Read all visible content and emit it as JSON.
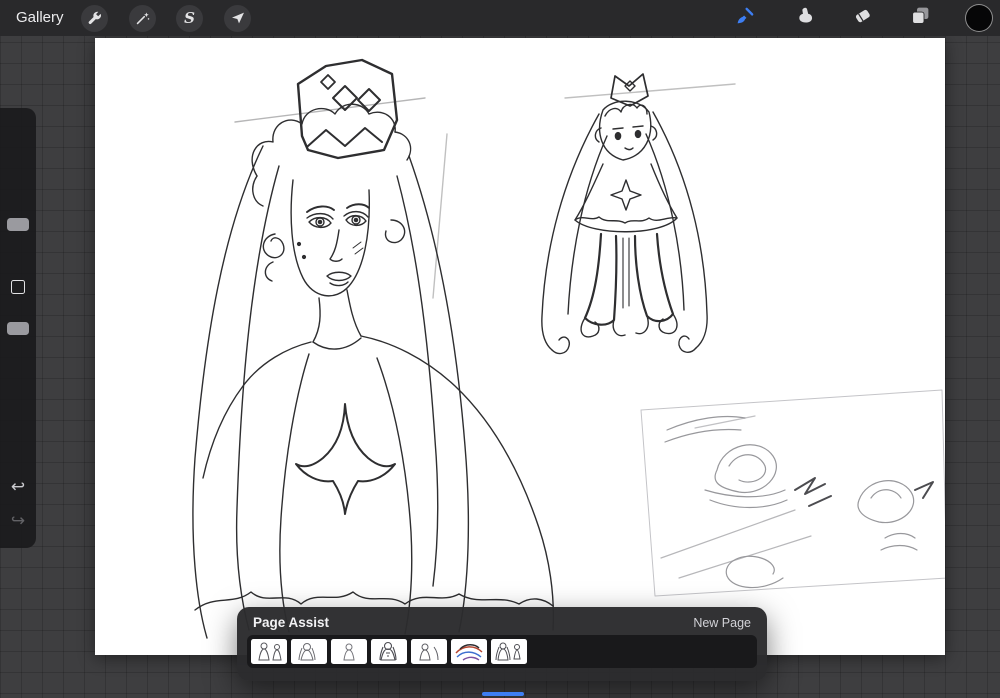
{
  "top_bar": {
    "gallery_label": "Gallery",
    "selection_letter": "S",
    "left_tools": [
      "actions-wrench-icon",
      "adjustments-wand-icon",
      "selection-s-icon",
      "transform-arrow-icon"
    ],
    "right_tools": [
      "paint-brush-icon",
      "smudge-finger-icon",
      "eraser-icon",
      "layers-icon",
      "color-swatch"
    ],
    "selected_tool": "paint-brush",
    "current_color": "#060607"
  },
  "sidebar": {
    "controls": [
      "brush-size-slider",
      "modify-button",
      "opacity-slider",
      "undo-button",
      "redo-button"
    ]
  },
  "icons": {
    "undo": "↩",
    "redo": "↪"
  },
  "page_assist": {
    "title": "Page Assist",
    "new_page_label": "New Page",
    "page_count": 7,
    "current_page": 7
  },
  "colors": {
    "accent_blue": "#3d7ef2",
    "canvas_background": "#ffffff",
    "top_bar_background": "#29292b",
    "panel_background": "#2b2b2d"
  }
}
